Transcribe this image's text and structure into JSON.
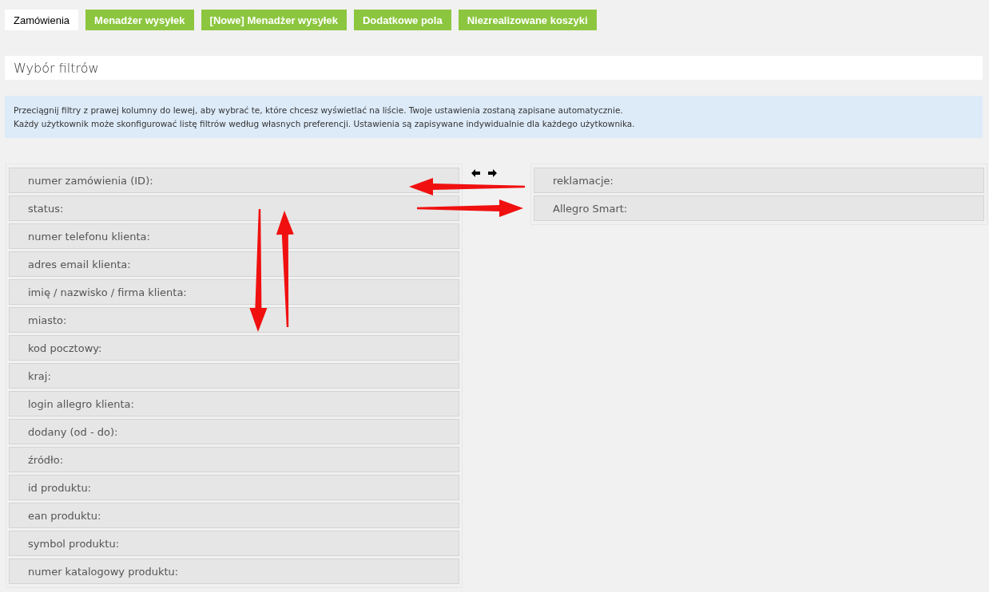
{
  "tabs": [
    {
      "label": "Zamówienia",
      "selected": true
    },
    {
      "label": "Menadżer wysyłek",
      "selected": false
    },
    {
      "label": "[Nowe] Menadżer wysyłek",
      "selected": false
    },
    {
      "label": "Dodatkowe pola",
      "selected": false
    },
    {
      "label": "Niezrealizowane koszyki",
      "selected": false
    }
  ],
  "section_title": "Wybór filtrów",
  "info": [
    "Przeciągnij filtry z prawej kolumny do lewej, aby wybrać te, które chcesz wyświetlać na liście. Twoje ustawienia zostaną zapisane automatycznie.",
    "Każdy użytkownik może skonfigurować listę filtrów według własnych preferencji. Ustawienia są zapisywane indywidualnie dla każdego użytkownika."
  ],
  "active_filters": [
    "numer zamówienia (ID):",
    "status:",
    "numer telefonu klienta:",
    "adres email klienta:",
    "imię / nazwisko / firma klienta:",
    "miasto:",
    "kod pocztowy:",
    "kraj:",
    "login allegro klienta:",
    "dodany (od - do):",
    "źródło:",
    "id produktu:",
    "ean produktu:",
    "symbol produktu:",
    "numer katalogowy produktu:"
  ],
  "available_filters": [
    "reklamacje:",
    "Allegro Smart:"
  ]
}
